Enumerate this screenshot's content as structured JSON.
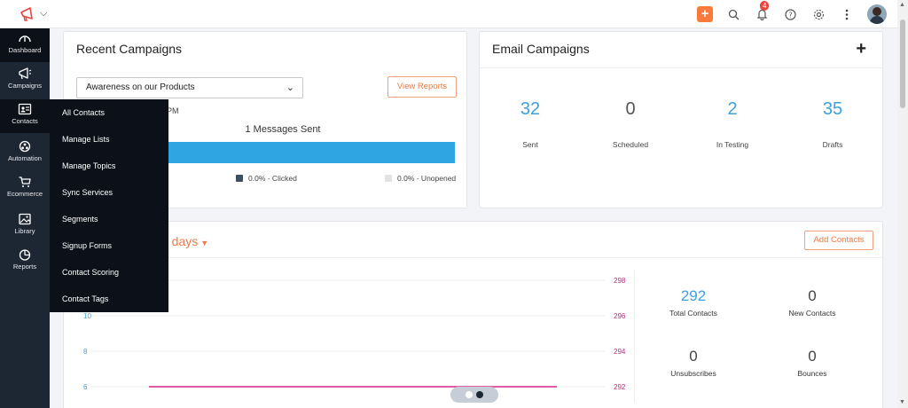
{
  "sidebar": {
    "items": [
      {
        "label": "Dashboard",
        "icon": "dashboard-gauge-icon"
      },
      {
        "label": "Campaigns",
        "icon": "megaphone-icon"
      },
      {
        "label": "Contacts",
        "icon": "contact-card-icon"
      },
      {
        "label": "Automation",
        "icon": "automation-icon"
      },
      {
        "label": "Ecommerce",
        "icon": "cart-icon"
      },
      {
        "label": "Library",
        "icon": "image-gallery-icon"
      },
      {
        "label": "Reports",
        "icon": "pie-chart-icon"
      }
    ]
  },
  "flyout": {
    "items": [
      "All Contacts",
      "Manage Lists",
      "Manage Topics",
      "Sync Services",
      "Segments",
      "Signup Forms",
      "Contact Scoring",
      "Contact Tags"
    ]
  },
  "header": {
    "notification_count": "4",
    "accent": "#f97a3a"
  },
  "recent": {
    "title": "Recent Campaigns",
    "selected_campaign": "Awareness on our Products",
    "view_reports": "View Reports",
    "time_fragment": "PM",
    "sent_heading": "1 Messages Sent",
    "legend_clicked": "0.0% - Clicked",
    "legend_unopened": "0.0% - Unopened",
    "bar_color": "#2fa6e2"
  },
  "email": {
    "title": "Email Campaigns",
    "plus": "+",
    "stats": [
      {
        "value": "32",
        "label": "Sent"
      },
      {
        "value": "0",
        "label": "Scheduled"
      },
      {
        "value": "2",
        "label": "In Testing"
      },
      {
        "value": "35",
        "label": "Drafts"
      }
    ]
  },
  "contacts": {
    "period": "0 days",
    "add_button": "Add Contacts",
    "totals": [
      {
        "value": "292",
        "label": "Total Contacts"
      },
      {
        "value": "0",
        "label": "New Contacts"
      },
      {
        "value": "0",
        "label": "Unsubscribes"
      },
      {
        "value": "0",
        "label": "Bounces"
      }
    ]
  },
  "chart_data": {
    "type": "line",
    "left_axis_ticks": [
      "10",
      "8",
      "6"
    ],
    "right_axis_ticks": [
      "298",
      "296",
      "294",
      "292"
    ],
    "series": [
      {
        "color": "#d6278a",
        "y_right": 292
      }
    ]
  }
}
